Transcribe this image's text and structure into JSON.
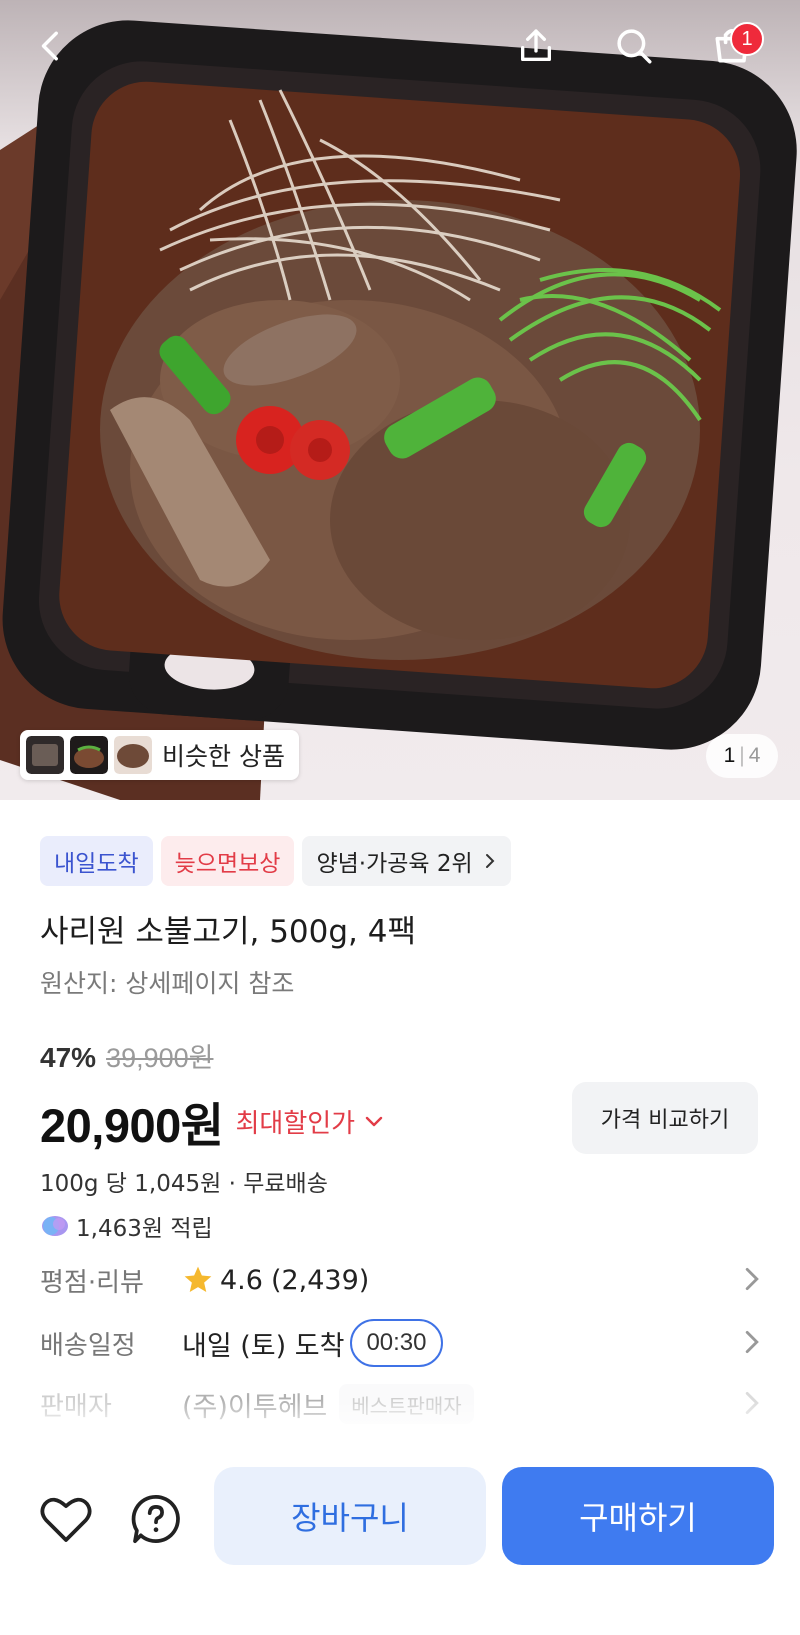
{
  "header": {
    "cart_badge": "1"
  },
  "gallery": {
    "similar_label": "비슷한 상품",
    "page_current": "1",
    "page_separator": "|",
    "page_total": "4"
  },
  "tags": [
    {
      "label": "내일도착"
    },
    {
      "label": "늦으면보상"
    },
    {
      "label": "양념·가공육 2위"
    }
  ],
  "product": {
    "title": "사리원 소불고기, 500g, 4팩",
    "origin": "원산지: 상세페이지 참조",
    "discount_rate": "47%",
    "original_price": "39,900원",
    "price": "20,900원",
    "max_discount_label": "최대할인가",
    "compare_label": "가격 비교하기",
    "unit_price": "100g 당 1,045원 · 무료배송",
    "reward": "1,463원 적립"
  },
  "info_rows": {
    "review": {
      "label": "평점·리뷰",
      "rating": "4.6",
      "count": "(2,439)"
    },
    "delivery": {
      "label": "배송일정",
      "value": "내일 (토) 도착",
      "time": "00:30"
    },
    "seller": {
      "label": "판매자",
      "value": "(주)이투헤브",
      "badge": "베스트판매자"
    }
  },
  "bottom": {
    "cart_label": "장바구니",
    "buy_label": "구매하기"
  },
  "colors": {
    "accent_blue": "#3f7bf0",
    "sale_red": "#e23c47",
    "badge_red": "#ef2a3b"
  },
  "icons": [
    "back-icon",
    "share-icon",
    "search-icon",
    "cart-icon",
    "heart-icon",
    "question-icon",
    "star-icon",
    "chevron-right-icon",
    "chevron-down-icon",
    "reward-coin-icon"
  ]
}
